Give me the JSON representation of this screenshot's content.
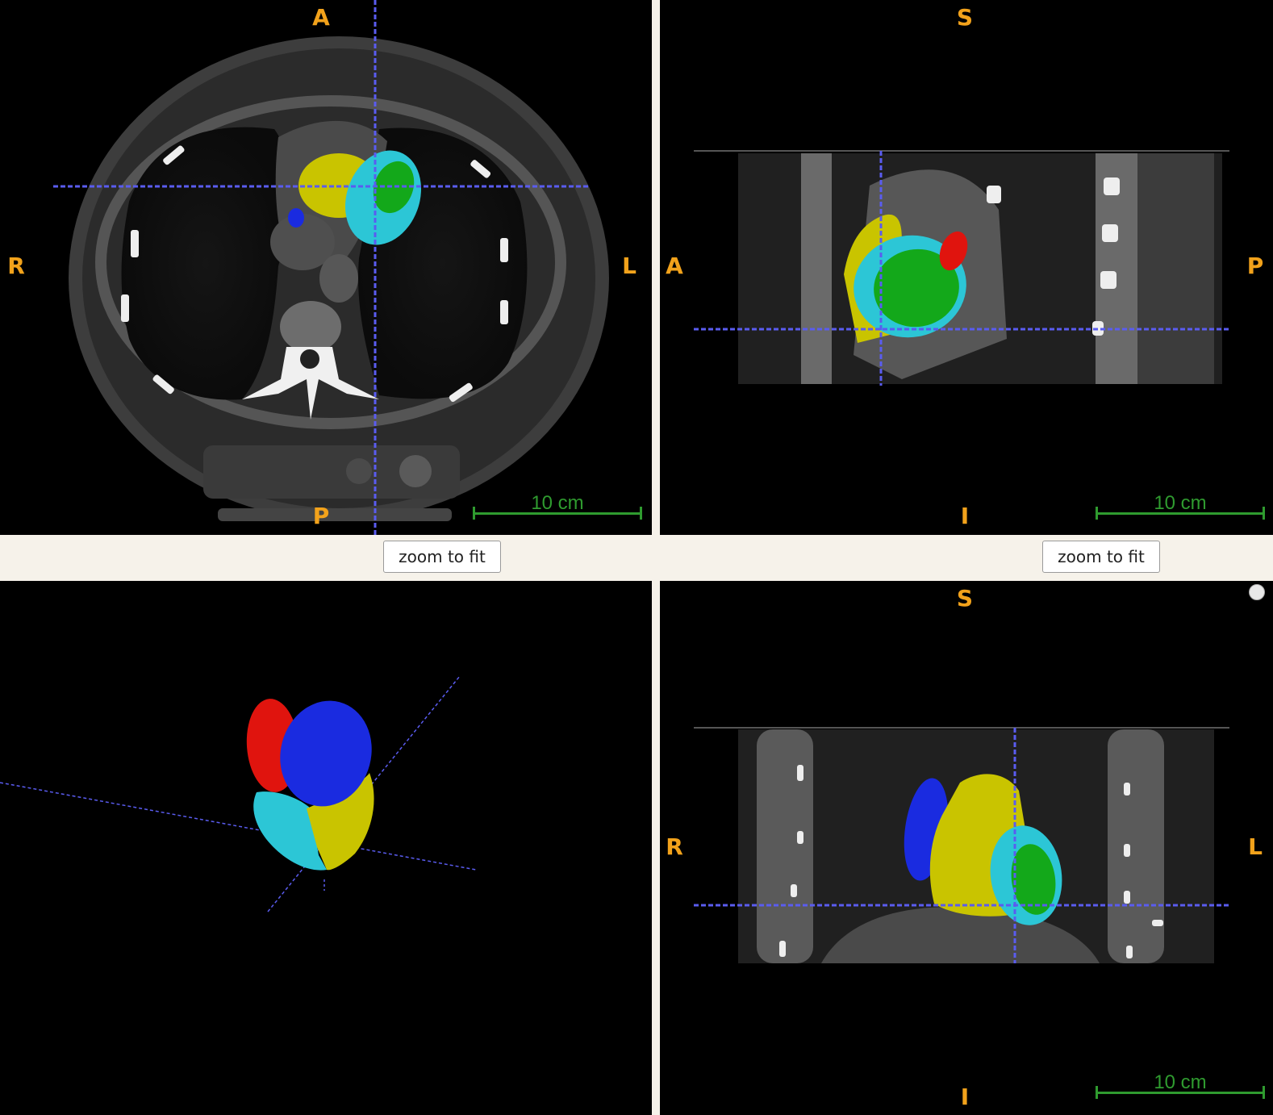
{
  "axial": {
    "labels": {
      "top": "A",
      "bottom": "P",
      "left": "R",
      "right": "L"
    },
    "scalebar": "10 cm"
  },
  "sagittal": {
    "labels": {
      "top": "S",
      "bottom": "I",
      "left": "A",
      "right": "P"
    },
    "scalebar": "10 cm"
  },
  "coronal": {
    "labels": {
      "top": "S",
      "bottom": "I",
      "left": "R",
      "right": "L"
    },
    "scalebar": "10 cm"
  },
  "buttons": {
    "zoom_left": "zoom to fit",
    "zoom_right": "zoom to fit"
  },
  "colors": {
    "crosshair": "#5a5cf0",
    "orientation_label": "#f2a21b",
    "scalebar": "#2f9b2f",
    "segment_yellow": "#c9c400",
    "segment_cyan": "#2cc6d6",
    "segment_green": "#13a81a",
    "segment_red": "#e0140e",
    "segment_blue": "#1a2be0"
  }
}
